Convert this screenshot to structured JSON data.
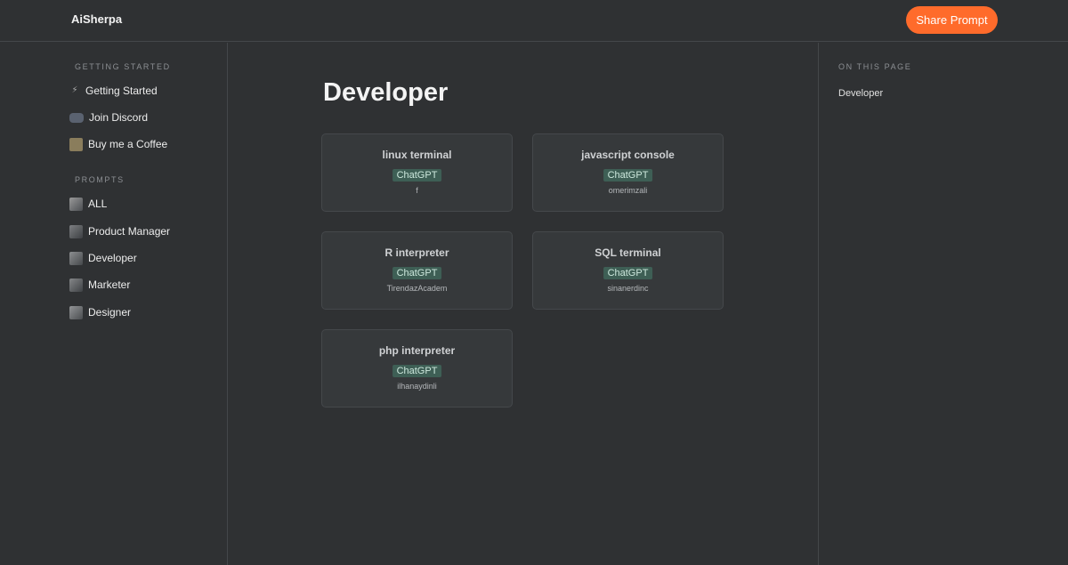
{
  "header": {
    "brand": "AiSherpa",
    "share_label": "Share Prompt",
    "accent": "#ff6b2b"
  },
  "sidebar": {
    "getting_started_title": "GETTING STARTED",
    "getting_started": [
      {
        "label": "Getting Started",
        "icon": "lightning-icon"
      },
      {
        "label": "Join Discord",
        "icon": "discord-icon"
      },
      {
        "label": "Buy me a Coffee",
        "icon": "coffee-icon"
      }
    ],
    "prompts_title": "PROMPTS",
    "prompts": [
      {
        "label": "ALL",
        "icon": "avatar-icon"
      },
      {
        "label": "Product Manager",
        "icon": "avatar-icon"
      },
      {
        "label": "Developer",
        "icon": "avatar-icon"
      },
      {
        "label": "Marketer",
        "icon": "avatar-icon"
      },
      {
        "label": "Designer",
        "icon": "avatar-icon"
      }
    ]
  },
  "main": {
    "title": "Developer",
    "cards": [
      {
        "title": "linux terminal",
        "badge": "ChatGPT",
        "author": "f"
      },
      {
        "title": "javascript console",
        "badge": "ChatGPT",
        "author": "omerimzali"
      },
      {
        "title": "R interpreter",
        "badge": "ChatGPT",
        "author": "TirendazAcadem"
      },
      {
        "title": "SQL terminal",
        "badge": "ChatGPT",
        "author": "sinanerdinc"
      },
      {
        "title": "php interpreter",
        "badge": "ChatGPT",
        "author": "ilhanaydinli"
      }
    ]
  },
  "toc": {
    "title": "ON THIS PAGE",
    "links": [
      "Developer"
    ]
  }
}
